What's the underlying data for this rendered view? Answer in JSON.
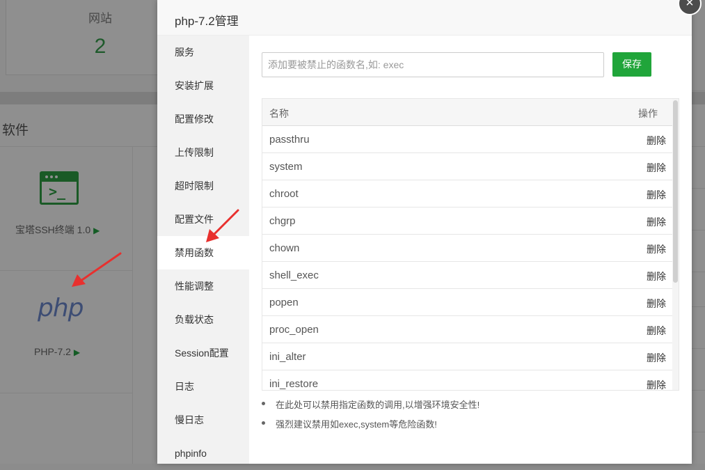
{
  "background": {
    "stat": {
      "label": "网站",
      "value": "2"
    },
    "software_title": "软件",
    "ssh_app": {
      "label": "宝塔SSH终端 1.0",
      "arrow": "▶"
    },
    "php_app": {
      "logo": "php",
      "label": "PHP-7.2",
      "arrow": "▶"
    }
  },
  "modal": {
    "title": "php-7.2管理",
    "close_icon": "×",
    "nav": [
      {
        "label": "服务",
        "active": false
      },
      {
        "label": "安装扩展",
        "active": false
      },
      {
        "label": "配置修改",
        "active": false
      },
      {
        "label": "上传限制",
        "active": false
      },
      {
        "label": "超时限制",
        "active": false
      },
      {
        "label": "配置文件",
        "active": false
      },
      {
        "label": "禁用函数",
        "active": true
      },
      {
        "label": "性能调整",
        "active": false
      },
      {
        "label": "负载状态",
        "active": false
      },
      {
        "label": "Session配置",
        "active": false
      },
      {
        "label": "日志",
        "active": false
      },
      {
        "label": "慢日志",
        "active": false
      },
      {
        "label": "phpinfo",
        "active": false
      }
    ],
    "input": {
      "placeholder": "添加要被禁止的函数名,如: exec",
      "value": ""
    },
    "save_label": "保存",
    "table": {
      "headers": {
        "name": "名称",
        "action": "操作"
      },
      "rows": [
        {
          "name": "passthru",
          "action": "删除"
        },
        {
          "name": "system",
          "action": "删除"
        },
        {
          "name": "chroot",
          "action": "删除"
        },
        {
          "name": "chgrp",
          "action": "删除"
        },
        {
          "name": "chown",
          "action": "删除"
        },
        {
          "name": "shell_exec",
          "action": "删除"
        },
        {
          "name": "popen",
          "action": "删除"
        },
        {
          "name": "proc_open",
          "action": "删除"
        },
        {
          "name": "ini_alter",
          "action": "删除"
        },
        {
          "name": "ini_restore",
          "action": "删除"
        }
      ]
    },
    "tips": [
      "在此处可以禁用指定函数的调用,以增强环境安全性!",
      "强烈建议禁用如exec,system等危险函数!"
    ]
  },
  "colors": {
    "accent": "#20a53a",
    "arrow": "#e8302e"
  }
}
